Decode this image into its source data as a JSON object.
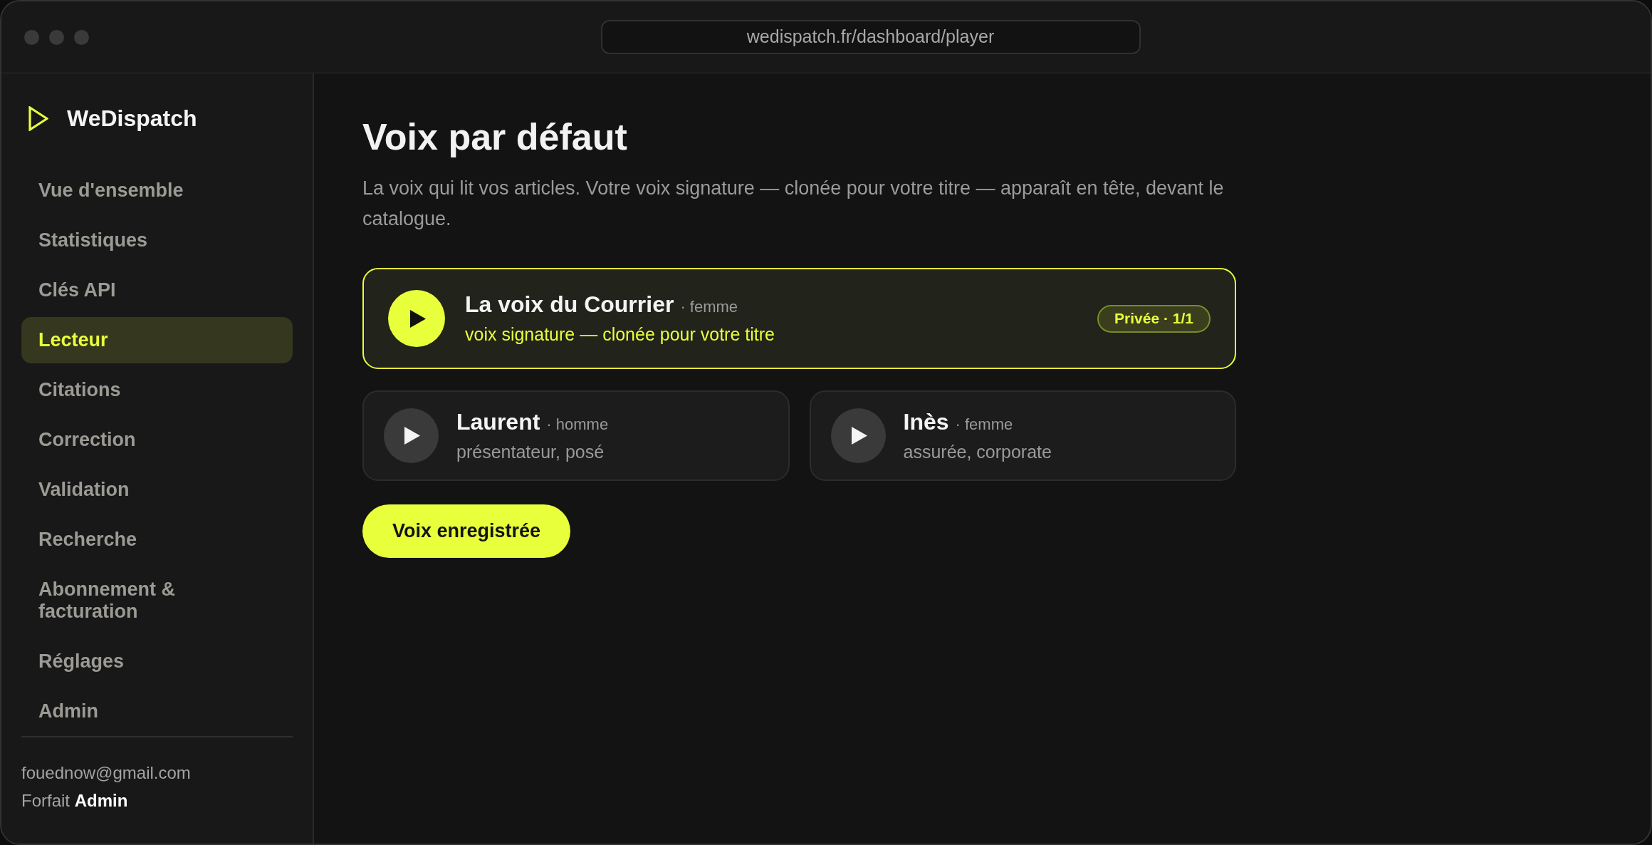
{
  "browser": {
    "url": "wedispatch.fr/dashboard/player"
  },
  "sidebar": {
    "brand": "WeDispatch",
    "items": [
      {
        "label": "Vue d'ensemble",
        "selected": false
      },
      {
        "label": "Statistiques",
        "selected": false
      },
      {
        "label": "Clés API",
        "selected": false
      },
      {
        "label": "Lecteur",
        "selected": true
      },
      {
        "label": "Citations",
        "selected": false
      },
      {
        "label": "Correction",
        "selected": false
      },
      {
        "label": "Validation",
        "selected": false
      },
      {
        "label": "Recherche",
        "selected": false
      },
      {
        "label": "Abonnement & facturation",
        "selected": false
      },
      {
        "label": "Réglages",
        "selected": false
      },
      {
        "label": "Admin",
        "selected": false
      }
    ],
    "account": {
      "email": "fouednow@gmail.com",
      "plan": "Forfait **Admin**"
    }
  },
  "main": {
    "title": "Voix par défaut",
    "description": "La voix qui lit vos articles. Votre voix signature — clonée pour votre titre — apparaît en tête, devant le catalogue.",
    "voices": [
      {
        "kind": "signature",
        "name": "La voix du Courrier",
        "gender": "· femme",
        "description": "voix signature — clonée pour votre titre",
        "badge": "Privée · 1/1",
        "selected": true
      },
      {
        "kind": "catalog",
        "name": "Laurent",
        "gender": "· homme",
        "description": "présentateur, posé",
        "selected": false
      },
      {
        "kind": "catalog",
        "name": "Inès",
        "gender": "· femme",
        "description": "assurée, corporate",
        "selected": false
      }
    ],
    "save_button": "Voix enregistrée"
  }
}
